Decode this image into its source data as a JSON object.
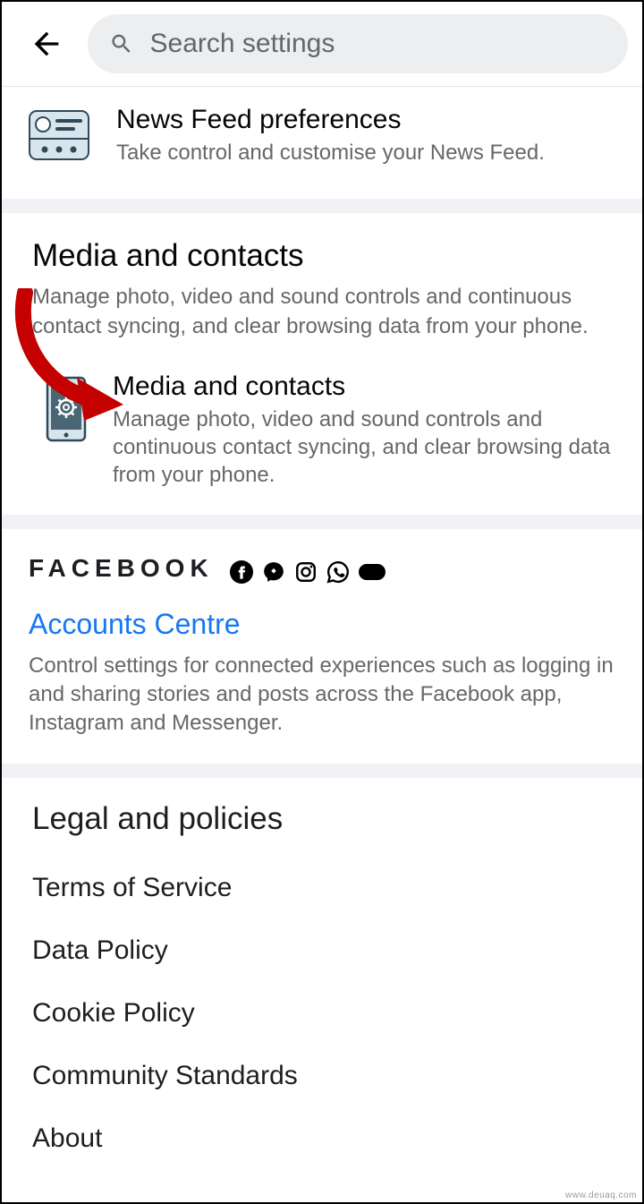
{
  "header": {
    "search_placeholder": "Search settings"
  },
  "news_feed": {
    "title": "News Feed preferences",
    "desc": "Take control and customise your News Feed."
  },
  "media_section": {
    "title": "Media and contacts",
    "desc": "Manage photo, video and sound controls and continuous contact syncing, and clear browsing data from your phone.",
    "item_title": "Media and contacts",
    "item_desc": "Manage photo, video and sound controls and continuous contact syncing, and clear browsing data from your phone."
  },
  "accounts": {
    "brand_word": "FACEBOOK",
    "link": "Accounts Centre",
    "desc": "Control settings for connected experiences such as logging in and sharing stories and posts across the Facebook app, Instagram and Messenger."
  },
  "legal": {
    "title": "Legal and policies",
    "items": [
      "Terms of Service",
      "Data Policy",
      "Cookie Policy",
      "Community Standards",
      "About"
    ]
  },
  "watermark": "www.deuaq.com"
}
